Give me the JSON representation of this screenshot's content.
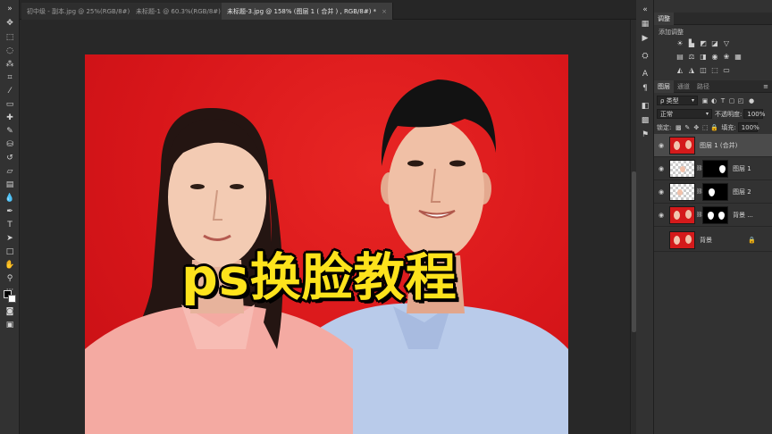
{
  "tabs": [
    {
      "label": "初中级 - 副本.jpg @ 25%(RGB/8#)",
      "close": "×",
      "active": false
    },
    {
      "label": "未标题-1 @ 60.3%(RGB/8#) *",
      "close": "×",
      "active": false
    },
    {
      "label": "未标题-3.jpg @ 158% (图层 1 ( 合并 ) , RGB/8#) *",
      "close": "×",
      "active": true
    }
  ],
  "canvas": {
    "overlay_text": "ps换脸教程"
  },
  "panels": {
    "adjust_tab": "调整",
    "adjust_add_label": "添加调整",
    "layers_tabs": [
      "图层",
      "通道",
      "路径"
    ],
    "filter_kind": "ρ 类型",
    "blend_mode": "正常",
    "opacity_label": "不透明度:",
    "opacity_value": "100%",
    "lock_label": "锁定:",
    "fill_label": "填充:",
    "fill_value": "100%",
    "layers": [
      {
        "name": "图层 1 (合并)",
        "selected": true
      },
      {
        "name": "图层 1",
        "selected": false
      },
      {
        "name": "图层 2",
        "selected": false
      },
      {
        "name": "背景 ...",
        "selected": false
      },
      {
        "name": "背景",
        "selected": false
      }
    ]
  },
  "icons": {
    "eye": "eye-icon",
    "lock": "lock-icon",
    "chain": "link-icon"
  }
}
